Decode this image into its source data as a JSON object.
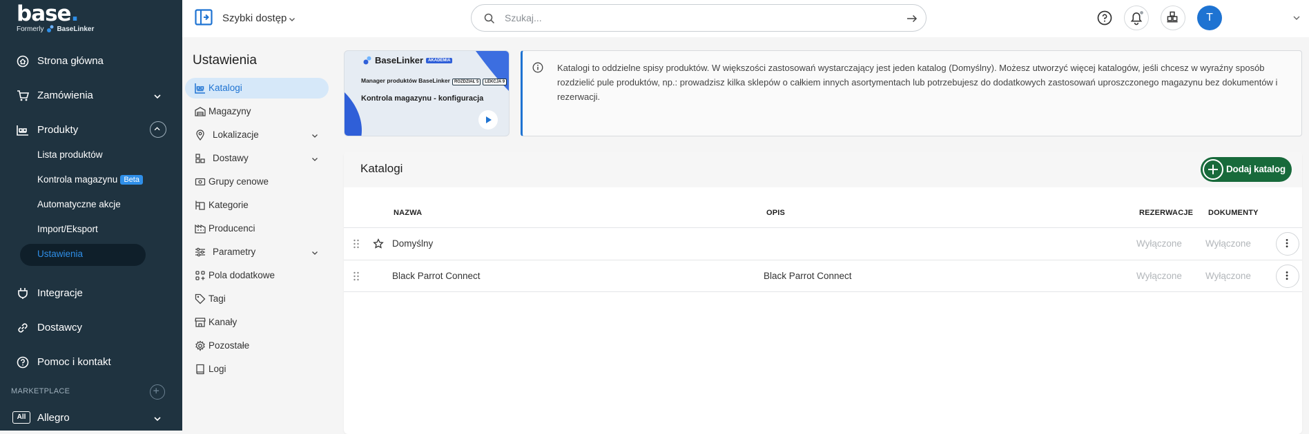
{
  "brand": {
    "logo": "base",
    "formerly": "Formerly",
    "former_name": "BaseLinker"
  },
  "sidebar": {
    "nav": [
      {
        "label": "Strona główna",
        "icon": "home-icon"
      },
      {
        "label": "Zamówienia",
        "icon": "cart-icon"
      },
      {
        "label": "Produkty",
        "icon": "warehouse-icon"
      },
      {
        "label": "Integracje",
        "icon": "plug-icon"
      },
      {
        "label": "Dostawcy",
        "icon": "link-icon"
      },
      {
        "label": "Pomoc i kontakt",
        "icon": "help-icon"
      }
    ],
    "products_sub": [
      {
        "label": "Lista produktów"
      },
      {
        "label": "Kontrola magazynu",
        "badge": "Beta"
      },
      {
        "label": "Automatyczne akcje"
      },
      {
        "label": "Import/Eksport"
      },
      {
        "label": "Ustawienia",
        "active": true
      }
    ],
    "marketplace_label": "MARKETPLACE",
    "marketplace_item": {
      "badge": "All",
      "label": "Allegro"
    }
  },
  "topbar": {
    "quick_access": "Szybki dostęp",
    "search_placeholder": "Szukaj...",
    "avatar_letter": "T",
    "icons": [
      "help-icon",
      "bell-icon",
      "apps-icon"
    ]
  },
  "settings_menu": {
    "title": "Ustawienia",
    "items": [
      {
        "label": "Katalogi",
        "icon": "catalog-icon",
        "active": true
      },
      {
        "label": "Magazyny",
        "icon": "warehouse-icon"
      },
      {
        "label": "Lokalizacje",
        "icon": "location-icon",
        "expandable": true
      },
      {
        "label": "Dostawy",
        "icon": "delivery-icon",
        "expandable": true
      },
      {
        "label": "Grupy cenowe",
        "icon": "price-icon"
      },
      {
        "label": "Kategorie",
        "icon": "category-icon"
      },
      {
        "label": "Producenci",
        "icon": "factory-icon"
      },
      {
        "label": "Parametry",
        "icon": "sliders-icon",
        "expandable": true
      },
      {
        "label": "Pola dodatkowe",
        "icon": "fields-icon"
      },
      {
        "label": "Tagi",
        "icon": "tag-icon"
      },
      {
        "label": "Kanały",
        "icon": "store-icon"
      },
      {
        "label": "Pozostałe",
        "icon": "gear-icon"
      },
      {
        "label": "Logi",
        "icon": "book-icon"
      }
    ]
  },
  "banner": {
    "brand": "BaseLinker",
    "brand_tag": "AKADEMIA",
    "line1": "Manager produktów BaseLinker",
    "tag1": "ROZDZIAŁ 5",
    "tag2": "LEKCJA 9",
    "line2": "Kontrola magazynu - konfiguracja"
  },
  "info": {
    "text": "Katalogi to oddzielne spisy produktów. W większości zastosowań wystarczający jest jeden katalog (Domyślny). Możesz utworzyć więcej katalogów, jeśli chcesz w wyraźny sposób rozdzielić pule produktów, np.: prowadzisz kilka sklepów o całkiem innych asortymentach lub potrzebujesz do dodatkowych zastosowań uproszczonego magazynu bez dokumentów i rezerwacji."
  },
  "catalogs": {
    "title": "Katalogi",
    "add_button": "Dodaj katalog",
    "columns": {
      "name": "NAZWA",
      "description": "OPIS",
      "reservations": "REZERWACJE",
      "documents": "DOKUMENTY"
    },
    "rows": [
      {
        "name": "Domyślny",
        "description": "",
        "reservations": "Wyłączone",
        "documents": "Wyłączone",
        "default": true
      },
      {
        "name": "Black Parrot Connect",
        "description": "Black Parrot Connect",
        "reservations": "Wyłączone",
        "documents": "Wyłączone",
        "default": false
      }
    ]
  },
  "colors": {
    "sidebar_bg": "#1f3340",
    "accent": "#1e73d2",
    "add_button": "#186a3b",
    "active_menu_bg": "#d6e8f9"
  }
}
